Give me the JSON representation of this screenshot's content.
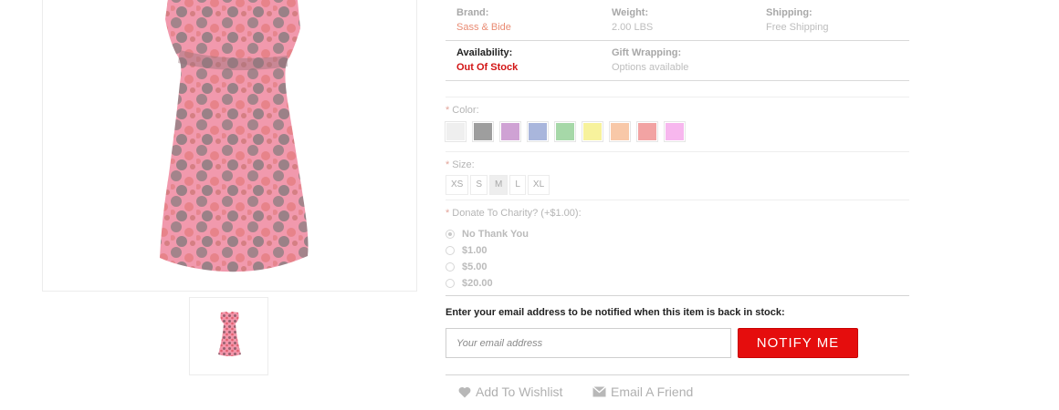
{
  "colors": {
    "accent_red": "#e50d0d",
    "out_of_stock": "#d21414",
    "brand_link": "#e98b73",
    "swatches": [
      "#efefef",
      "#9e9e9e",
      "#cfa2d4",
      "#a9b6dc",
      "#a6d8a8",
      "#f7f29c",
      "#f8c8a8",
      "#f2a3a3",
      "#f7b7ee"
    ]
  },
  "specs": {
    "brand_label": "Brand:",
    "brand_value": "Sass & Bide",
    "weight_label": "Weight:",
    "weight_value": "2.00 LBS",
    "shipping_label": "Shipping:",
    "shipping_value": "Free Shipping",
    "availability_label": "Availability:",
    "availability_value": "Out Of Stock",
    "gift_label": "Gift Wrapping:",
    "gift_value": "Options available"
  },
  "options": {
    "required_mark": "*",
    "color_label": "Color:",
    "size_label": "Size:",
    "sizes": [
      "XS",
      "S",
      "M",
      "L",
      "XL"
    ],
    "selected_size": "M",
    "charity_label": "Donate To Charity? (+$1.00):",
    "charity_choices": [
      "No Thank You",
      "$1.00",
      "$5.00",
      "$20.00"
    ],
    "selected_charity": "No Thank You"
  },
  "notify": {
    "prompt": "Enter your email address to be notified when this item is back in stock:",
    "email_placeholder": "Your email address",
    "button_label": "NOTIFY ME"
  },
  "links": {
    "wishlist_label": "Add To Wishlist",
    "wishlist_icon": "heart-icon",
    "email_friend_label": "Email A Friend",
    "email_friend_icon": "envelope-icon"
  }
}
